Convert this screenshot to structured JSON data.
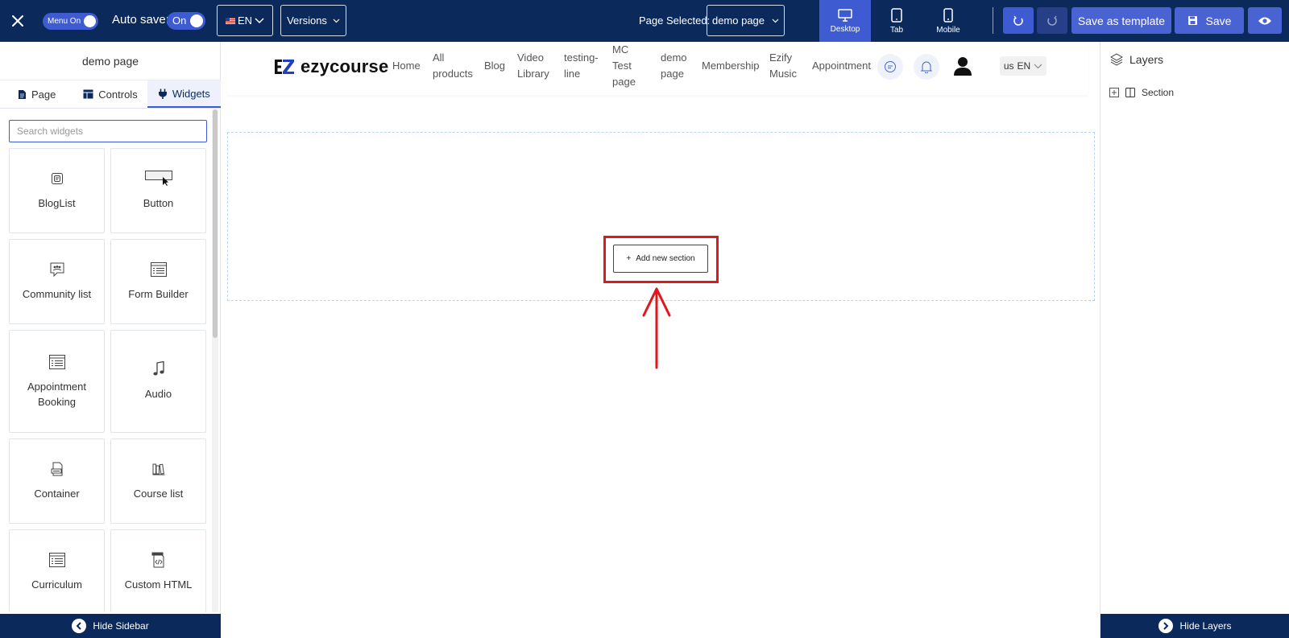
{
  "topbar": {
    "menu_toggle_label": "Menu On",
    "autosave_label": "Auto save:",
    "autosave_state": "On",
    "language": "EN",
    "versions_label": "Versions",
    "page_selected_label": "Page Selected:",
    "page_selected_value": "demo page",
    "devices": [
      {
        "label": "Desktop",
        "icon": "desktop-icon",
        "active": true
      },
      {
        "label": "Tab",
        "icon": "tablet-icon",
        "active": false
      },
      {
        "label": "Mobile",
        "icon": "mobile-icon",
        "active": false
      }
    ],
    "save_as_template_label": "Save as template",
    "save_label": "Save"
  },
  "sidebar": {
    "title": "demo page",
    "tabs": [
      {
        "label": "Page",
        "icon": "page-icon"
      },
      {
        "label": "Controls",
        "icon": "controls-icon"
      },
      {
        "label": "Widgets",
        "icon": "plug-icon",
        "active": true
      }
    ],
    "search_placeholder": "Search widgets",
    "widgets": [
      {
        "label": "BlogList",
        "icon": "bloglist-icon"
      },
      {
        "label": "Button",
        "icon": "button-icon"
      },
      {
        "label": "Community list",
        "icon": "community-icon"
      },
      {
        "label": "Form Builder",
        "icon": "form-icon"
      },
      {
        "label": "Appointment Booking",
        "icon": "appointment-icon"
      },
      {
        "label": "Audio",
        "icon": "music-note-icon"
      },
      {
        "label": "Container",
        "icon": "container-icon"
      },
      {
        "label": "Course list",
        "icon": "books-icon"
      },
      {
        "label": "Curriculum",
        "icon": "curriculum-icon"
      },
      {
        "label": "Custom HTML",
        "icon": "html-code-icon"
      }
    ],
    "hide_label": "Hide Sidebar"
  },
  "site": {
    "logo_text": "ezycourse",
    "nav": [
      "Home",
      "All products",
      "Blog",
      "Video Library",
      "testing-line",
      "MC Test page",
      "demo page",
      "Membership",
      "Ezify Music",
      "Appointment"
    ],
    "lang_country": "us",
    "lang_code": "EN"
  },
  "canvas": {
    "add_section_label": "Add new section"
  },
  "layers": {
    "title": "Layers",
    "items": [
      {
        "label": "Section"
      }
    ],
    "hide_label": "Hide Layers"
  },
  "colors": {
    "topbar_bg": "#0b2a5b",
    "accent": "#3f5bd1",
    "annotation_red": "#e0171d"
  }
}
